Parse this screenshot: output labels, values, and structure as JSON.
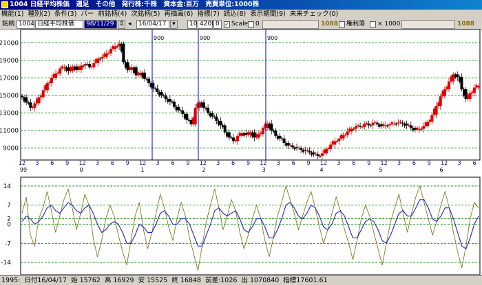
{
  "window": {
    "title": "1004 日経平均株価　週足　その他　発行株:千株　資本金:百万　売買単位:1000株"
  },
  "menu": [
    "機能(1)",
    "種別(2)",
    "条件(3)",
    "バー",
    "前銘柄(4)",
    "次銘柄(5)",
    "再描画(6)",
    "指標(7)",
    "読込(8)",
    "表示期間(9)",
    "未来チェック(0)"
  ],
  "toolbar": {
    "label": "銘柄",
    "code": "1004",
    "name": "日経平均株価",
    "start_date": "98/11/29",
    "end_date": "16/04/17",
    "period": "10",
    "bars": "4200",
    "offset": "0",
    "scale_label": "Scale",
    "scale_value": "0",
    "left_count": "1088",
    "rights_label": "権利落",
    "multiplier_label": "× 1000",
    "right_count": "1088"
  },
  "chart_data": [
    {
      "type": "candlestick",
      "yticks": [
        9000,
        11000,
        13000,
        15000,
        17000,
        19000,
        21000
      ],
      "ylim": [
        7800,
        22200
      ],
      "grid": true,
      "month_ticks": [
        "12",
        "3",
        "6",
        "9",
        "12",
        "3",
        "6",
        "9",
        "12",
        "3",
        "6",
        "9",
        "12",
        "3",
        "6",
        "9",
        "12",
        "3",
        "6",
        "9",
        "12",
        "3",
        "6",
        "9",
        "12",
        "3",
        "6",
        "9",
        "12",
        "3",
        "6"
      ],
      "year_labels": [
        "99",
        "0",
        "1",
        "2",
        "3",
        "4",
        "5",
        "6"
      ],
      "markers": [
        "900",
        "900",
        "900"
      ],
      "close_series": [
        14800,
        14200,
        13600,
        14100,
        14800,
        15600,
        16400,
        17000,
        17500,
        18100,
        18200,
        17800,
        18300,
        17900,
        18400,
        18600,
        18200,
        18700,
        19200,
        19400,
        19800,
        20300,
        20600,
        20900,
        18800,
        17900,
        18200,
        17300,
        17600,
        16900,
        16400,
        15800,
        15400,
        15000,
        14600,
        14300,
        13700,
        13300,
        12900,
        12200,
        11700,
        13600,
        14200,
        13600,
        13000,
        12600,
        12100,
        11600,
        10800,
        10200,
        9800,
        10400,
        10700,
        10500,
        10800,
        10200,
        10600,
        11300,
        11800,
        11000,
        10400,
        10100,
        9600,
        9300,
        9100,
        9000,
        8800,
        8700,
        8500,
        8300,
        8100,
        8400,
        8900,
        9400,
        9800,
        10100,
        10500,
        10900,
        11200,
        11500,
        11400,
        11800,
        11600,
        11900,
        11700,
        11500,
        11600,
        11700,
        11800,
        11900,
        11800,
        11600,
        11300,
        11100,
        11200,
        11500,
        12000,
        12800,
        13800,
        14900,
        15700,
        16600,
        17400,
        17100,
        15700,
        14600,
        15300,
        15900,
        16100
      ],
      "ohlc_source": "close_series"
    },
    {
      "type": "line",
      "yticks": [
        14,
        7,
        2,
        0,
        -7,
        -14
      ],
      "ylim": [
        -18.5,
        16.5
      ],
      "grid": true,
      "series": [
        {
          "color": "#807820",
          "values": [
            4,
            10,
            -4,
            -8,
            2,
            6,
            12,
            5,
            -3,
            3,
            9,
            13,
            6,
            -2,
            4,
            11,
            7,
            -5,
            -12,
            -6,
            2,
            7,
            3,
            -4,
            -10,
            -15,
            -6,
            3,
            8,
            -2,
            -9,
            -3,
            4,
            11,
            6,
            -1,
            -6,
            2,
            8,
            3,
            -5,
            -11,
            -17,
            -8,
            1,
            7,
            13,
            6,
            -2,
            3,
            9,
            5,
            -3,
            -9,
            -4,
            2,
            7,
            2,
            -6,
            -12,
            -5,
            3,
            8,
            14,
            9,
            4,
            -2,
            3,
            8,
            12,
            6,
            -1,
            -7,
            -2,
            4,
            10,
            5,
            -2,
            -7,
            -13,
            -6,
            2,
            7,
            3,
            -3,
            -9,
            -15,
            -7,
            1,
            6,
            11,
            4,
            -3,
            4,
            10,
            14,
            8,
            2,
            -4,
            1,
            7,
            12,
            6,
            -3,
            -10,
            -16,
            -8,
            2,
            8,
            6
          ]
        },
        {
          "color": "#2020d0",
          "values": [
            1,
            3,
            2,
            0,
            1,
            3,
            6,
            7,
            5,
            4,
            6,
            8,
            7,
            5,
            4,
            6,
            7,
            4,
            0,
            -3,
            -2,
            0,
            1,
            0,
            -3,
            -7,
            -7,
            -4,
            0,
            -1,
            -3,
            -3,
            0,
            4,
            5,
            3,
            0,
            0,
            2,
            2,
            0,
            -4,
            -8,
            -8,
            -4,
            0,
            5,
            6,
            4,
            3,
            4,
            5,
            2,
            -2,
            -3,
            -1,
            2,
            2,
            -1,
            -5,
            -5,
            -2,
            2,
            7,
            8,
            6,
            3,
            2,
            4,
            7,
            6,
            3,
            -1,
            -2,
            0,
            4,
            5,
            3,
            -1,
            -5,
            -5,
            -2,
            1,
            2,
            1,
            -2,
            -6,
            -7,
            -4,
            0,
            4,
            5,
            3,
            3,
            6,
            9,
            9,
            6,
            2,
            1,
            3,
            6,
            6,
            2,
            -3,
            -8,
            -9,
            -5,
            0,
            3
          ]
        }
      ]
    }
  ],
  "status": {
    "items": [
      "1995:",
      "日付16/04/17",
      "始 15762",
      "高 16929",
      "安 15525",
      "終 16848",
      "前差:1026",
      "出 1070840",
      "指標17601.61"
    ]
  },
  "colors": {
    "up": "#e00000",
    "down": "#000000",
    "grid": "#008000",
    "marker": "#0000c0"
  }
}
